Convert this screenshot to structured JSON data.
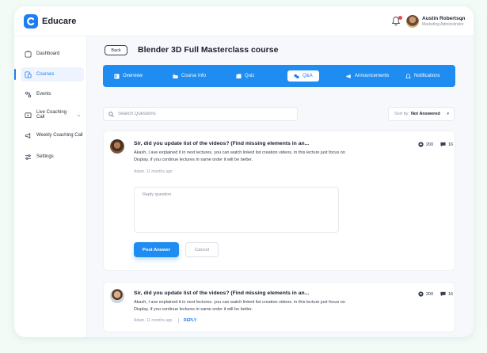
{
  "app": {
    "name": "Educare",
    "brand_color": "#1e8cf0"
  },
  "user": {
    "name": "Austin Robertson",
    "role": "Marketing Administrator"
  },
  "sidebar": {
    "items": [
      {
        "label": "Dashboard",
        "icon": "dashboard-icon"
      },
      {
        "label": "Courses",
        "icon": "courses-icon",
        "active": true
      },
      {
        "label": "Events",
        "icon": "events-icon"
      },
      {
        "label": "Live Coaching Call",
        "icon": "video-icon",
        "has_caret": true
      },
      {
        "label": "Weekly Coaching Call",
        "icon": "megaphone-icon"
      },
      {
        "label": "Settings",
        "icon": "settings-icon"
      }
    ]
  },
  "header": {
    "back_label": "Back",
    "course_title": "Blender 3D Full Masterclass course"
  },
  "tabs": [
    {
      "label": "Overview",
      "icon": "overview-icon"
    },
    {
      "label": "Course Info",
      "icon": "folder-icon"
    },
    {
      "label": "Quiz",
      "icon": "quiz-icon"
    },
    {
      "label": "Q&A",
      "icon": "qa-icon",
      "active": true
    },
    {
      "label": "Announcements",
      "icon": "megaphone-icon"
    },
    {
      "label": "Notifications",
      "icon": "bell-icon"
    }
  ],
  "search": {
    "placeholder": "Search Questions"
  },
  "sort": {
    "label": "Sort by:",
    "value": "Not Answered"
  },
  "questions": [
    {
      "title": "Sir, did you update list of the videos? (Find missing elements in an...",
      "body": "Akash, I ave explained it in next lectures. you can watch linked list creation videos. in this lecture just focus on Display. if you continue lectures in same order it will be better.",
      "meta": "Adam. 11 months ago",
      "votes": "200",
      "comments": "16",
      "reply_placeholder": "Reply question",
      "post_label": "Post Answer",
      "cancel_label": "Cancel"
    },
    {
      "title": "Sir, did you update list of the videos? (Find missing elements in an...",
      "body": "Akash, I ave explained it in next lectures. you can watch linked list creation videos. in this lecture just focus on Display. if you continue lectures in same order it will be better.",
      "meta": "Adam. 11 months ago",
      "reply_link": "REPLY",
      "votes": "200",
      "comments": "16"
    }
  ]
}
